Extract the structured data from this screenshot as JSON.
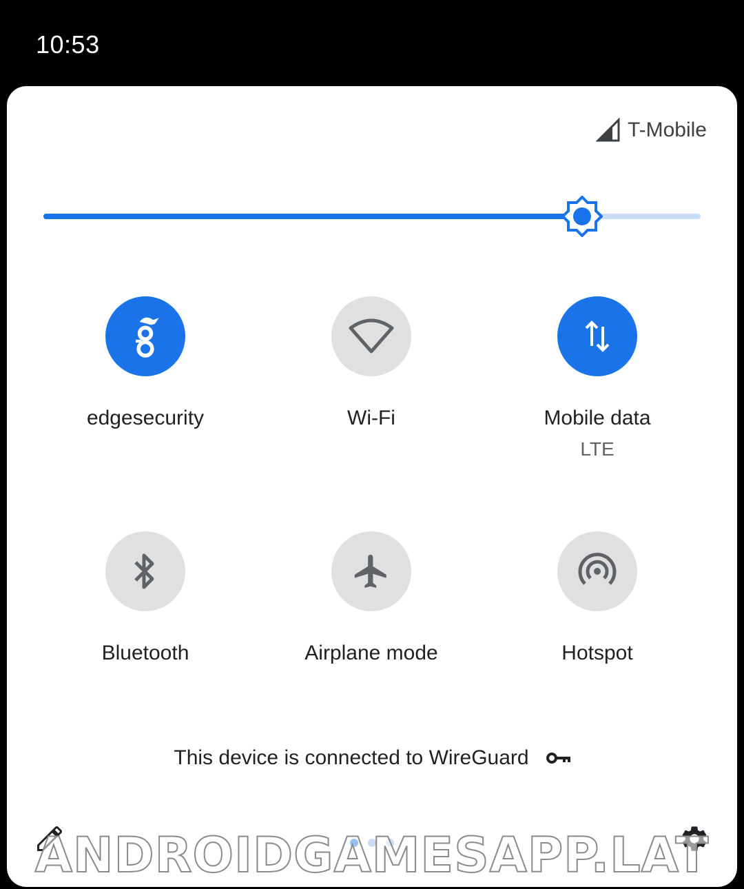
{
  "status_bar": {
    "time": "10:53"
  },
  "panel": {
    "carrier": "T-Mobile",
    "brightness": 0.82,
    "tiles": [
      {
        "label": "edgesecurity",
        "icon": "wireguard-dragon-icon",
        "on": true
      },
      {
        "label": "Wi-Fi",
        "icon": "wifi-icon",
        "on": false
      },
      {
        "label": "Mobile data",
        "sub": "LTE",
        "icon": "mobile-data-icon",
        "on": true
      },
      {
        "label": "Bluetooth",
        "icon": "bluetooth-icon",
        "on": false
      },
      {
        "label": "Airplane mode",
        "icon": "airplane-icon",
        "on": false
      },
      {
        "label": "Hotspot",
        "icon": "hotspot-icon",
        "on": false
      }
    ],
    "vpn_notice": "This device is connected to WireGuard",
    "page_indicator": {
      "total": 3,
      "current": 1
    }
  },
  "watermark": "ANDROIDGAMESAPP.LAT",
  "colors": {
    "accent": "#1a73e8",
    "tile_off": "#e0e0e0",
    "icon_off": "#5f6368"
  }
}
